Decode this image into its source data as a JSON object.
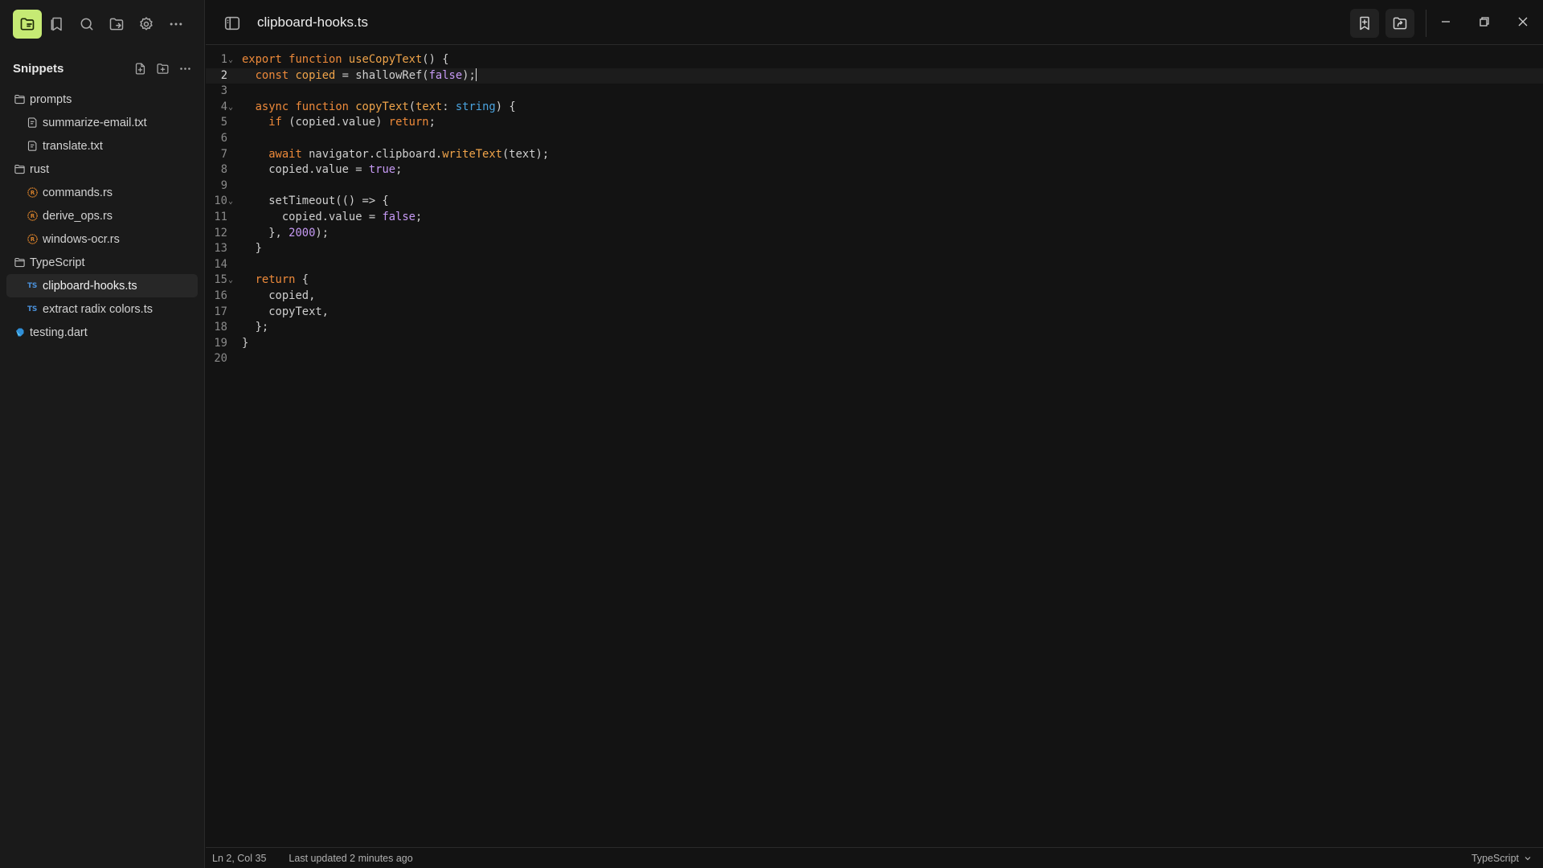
{
  "window": {
    "title": "clipboard-hooks.ts"
  },
  "rail": [
    {
      "name": "files-icon",
      "active": true
    },
    {
      "name": "bookmark-icon"
    },
    {
      "name": "search-icon"
    },
    {
      "name": "folder-share-icon"
    },
    {
      "name": "gear-icon"
    },
    {
      "name": "more-icon"
    }
  ],
  "sidebar": {
    "title": "Snippets",
    "tree": [
      {
        "label": "prompts",
        "kind": "folder",
        "depth": 0
      },
      {
        "label": "summarize-email.txt",
        "kind": "text",
        "depth": 1
      },
      {
        "label": "translate.txt",
        "kind": "text",
        "depth": 1
      },
      {
        "label": "rust",
        "kind": "folder",
        "depth": 0
      },
      {
        "label": "commands.rs",
        "kind": "rust",
        "depth": 1
      },
      {
        "label": "derive_ops.rs",
        "kind": "rust",
        "depth": 1
      },
      {
        "label": "windows-ocr.rs",
        "kind": "rust",
        "depth": 1
      },
      {
        "label": "TypeScript",
        "kind": "folder",
        "depth": 0
      },
      {
        "label": "clipboard-hooks.ts",
        "kind": "ts",
        "depth": 1,
        "selected": true
      },
      {
        "label": "extract radix colors.ts",
        "kind": "ts",
        "depth": 1
      },
      {
        "label": "testing.dart",
        "kind": "dart",
        "depth": 0
      }
    ],
    "ts_badge": "TS"
  },
  "editor": {
    "current_line": 2,
    "lines": [
      "export function useCopyText() {",
      "  const copied = shallowRef(false);",
      "",
      "  async function copyText(text: string) {",
      "    if (copied.value) return;",
      "",
      "    await navigator.clipboard.writeText(text);",
      "    copied.value = true;",
      "",
      "    setTimeout(() => {",
      "      copied.value = false;",
      "    }, 2000);",
      "  }",
      "",
      "  return {",
      "    copied,",
      "    copyText,",
      "  };",
      "}",
      ""
    ],
    "fold_lines": [
      1,
      4,
      10,
      15
    ]
  },
  "status": {
    "position": "Ln 2, Col 35",
    "updated": "Last updated 2 minutes ago",
    "language": "TypeScript"
  },
  "colors": {
    "accent": "#c6ea74",
    "keyword": "#ee8a3a",
    "type": "#4aa3df",
    "literal": "#c79af5",
    "background": "#131313"
  }
}
